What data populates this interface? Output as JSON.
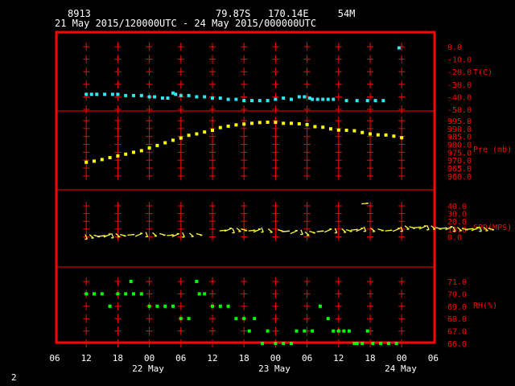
{
  "header": {
    "station": "8913",
    "location": "79.87S   170.14E     54M",
    "period": "21 May 2015/120000UTC - 24 May 2015/000000UTC"
  },
  "footer": {
    "page_number": "2"
  },
  "colors": {
    "frame": "#ff0000",
    "grid": "#ff0000",
    "text": "#ffffff",
    "temperature": "#33e5f0",
    "pressure": "#ffff00",
    "wind": "#ffff33",
    "rh": "#00ff00"
  },
  "chart_data": {
    "type": "scatter",
    "x_axis": {
      "tick_labels": [
        "06",
        "12",
        "18",
        "00",
        "06",
        "12",
        "18",
        "00",
        "06",
        "12",
        "18",
        "00",
        "06"
      ],
      "day_labels": [
        "22 May",
        "23 May",
        "24 May"
      ],
      "range_hours": [
        0,
        72
      ]
    },
    "panels": [
      {
        "name": "temperature",
        "label": "T(C)",
        "tick_labels": [
          "0.0",
          "-10.0",
          "-20.0",
          "-30.0",
          "-40.0",
          "-50.0"
        ],
        "ylim": [
          -50,
          0
        ],
        "points": [
          [
            6.0,
            -38
          ],
          [
            7.0,
            -38
          ],
          [
            8.0,
            -38
          ],
          [
            9.5,
            -38
          ],
          [
            11,
            -38
          ],
          [
            12,
            -38
          ],
          [
            13.5,
            -39
          ],
          [
            15,
            -39
          ],
          [
            16.5,
            -39
          ],
          [
            18,
            -40
          ],
          [
            19,
            -40
          ],
          [
            20.5,
            -41
          ],
          [
            21.5,
            -41
          ],
          [
            22.5,
            -37
          ],
          [
            23,
            -38
          ],
          [
            24,
            -39
          ],
          [
            25.5,
            -39
          ],
          [
            27,
            -40
          ],
          [
            28.5,
            -40
          ],
          [
            30,
            -41
          ],
          [
            31.5,
            -41
          ],
          [
            33,
            -42
          ],
          [
            34.5,
            -42
          ],
          [
            36,
            -43
          ],
          [
            37.5,
            -43
          ],
          [
            39,
            -43
          ],
          [
            40.5,
            -43
          ],
          [
            42,
            -42
          ],
          [
            43.5,
            -41
          ],
          [
            45,
            -42
          ],
          [
            46.5,
            -40
          ],
          [
            47.5,
            -40
          ],
          [
            48.5,
            -41
          ],
          [
            49,
            -42
          ],
          [
            50,
            -42
          ],
          [
            51,
            -42
          ],
          [
            52,
            -42
          ],
          [
            53,
            -42
          ],
          [
            55.5,
            -43
          ],
          [
            57.5,
            -43
          ],
          [
            59.5,
            -43
          ],
          [
            61,
            -43
          ],
          [
            62.5,
            -43
          ],
          [
            65.5,
            -1
          ]
        ]
      },
      {
        "name": "pressure",
        "label": "Pre (mb)",
        "tick_labels": [
          "995.0",
          "990.0",
          "985.0",
          "980.0",
          "975.0",
          "970.0",
          "965.0",
          "960.0"
        ],
        "ylim": [
          960,
          998
        ],
        "points": [
          [
            6,
            968.7
          ],
          [
            7.5,
            969.4
          ],
          [
            9,
            970.4
          ],
          [
            10.5,
            971.6
          ],
          [
            12,
            972.7
          ],
          [
            13.5,
            973.8
          ],
          [
            15,
            975
          ],
          [
            16.5,
            976
          ],
          [
            18,
            977.7
          ],
          [
            19.5,
            979.3
          ],
          [
            21,
            981
          ],
          [
            22.5,
            982.6
          ],
          [
            24,
            984
          ],
          [
            25.5,
            985.7
          ],
          [
            27,
            986.6
          ],
          [
            28.5,
            987.8
          ],
          [
            30,
            988.9
          ],
          [
            31.5,
            990.6
          ],
          [
            33,
            991.5
          ],
          [
            34.5,
            992.3
          ],
          [
            36,
            992.8
          ],
          [
            37.5,
            993.3
          ],
          [
            39,
            993.8
          ],
          [
            40.5,
            994
          ],
          [
            42,
            993.9
          ],
          [
            43.5,
            993.3
          ],
          [
            45,
            993.3
          ],
          [
            46.5,
            993
          ],
          [
            48,
            992.5
          ],
          [
            49.5,
            991.2
          ],
          [
            51,
            990.8
          ],
          [
            52.5,
            989.8
          ],
          [
            54,
            989
          ],
          [
            55.5,
            988.9
          ],
          [
            57,
            988.6
          ],
          [
            58.5,
            987.5
          ],
          [
            60,
            986.6
          ],
          [
            61.5,
            986
          ],
          [
            63,
            985.9
          ],
          [
            64.5,
            985.2
          ],
          [
            66,
            984.2
          ]
        ]
      },
      {
        "name": "wind_speed",
        "label": "SPD(MPS)",
        "tick_labels": [
          "40.0",
          "30.0",
          "20.0",
          "10.0",
          "0.0"
        ],
        "ylim": [
          0,
          48
        ],
        "points": [
          [
            6,
            0
          ],
          [
            7,
            0.5
          ],
          [
            8,
            1
          ],
          [
            9,
            1
          ],
          [
            10,
            1.5
          ],
          [
            11,
            1.5
          ],
          [
            12,
            2
          ],
          [
            13,
            2
          ],
          [
            14.5,
            2.5
          ],
          [
            16,
            2.5
          ],
          [
            17.5,
            3
          ],
          [
            19,
            3
          ],
          [
            20.5,
            3
          ],
          [
            22,
            2
          ],
          [
            23,
            2
          ],
          [
            24.5,
            2.5
          ],
          [
            26,
            2.5
          ],
          [
            27.5,
            3
          ],
          [
            32,
            8
          ],
          [
            33,
            9
          ],
          [
            34,
            8
          ],
          [
            35,
            9
          ],
          [
            36,
            9
          ],
          [
            37.5,
            8
          ],
          [
            38.5,
            8
          ],
          [
            39.5,
            9
          ],
          [
            41,
            8
          ],
          [
            43,
            8
          ],
          [
            44,
            7
          ],
          [
            45.5,
            6
          ],
          [
            47,
            6
          ],
          [
            48,
            4
          ],
          [
            49,
            6
          ],
          [
            50.5,
            7
          ],
          [
            52,
            8
          ],
          [
            53.5,
            8
          ],
          [
            55,
            8
          ],
          [
            56,
            8
          ],
          [
            57,
            9
          ],
          [
            58,
            9
          ],
          [
            59,
            10
          ],
          [
            60.5,
            9
          ],
          [
            62,
            9
          ],
          [
            63.5,
            8
          ],
          [
            65,
            9
          ],
          [
            66,
            10
          ],
          [
            67,
            12
          ],
          [
            68,
            12
          ],
          [
            69,
            12
          ],
          [
            70,
            12
          ],
          [
            71,
            12
          ],
          [
            72,
            12
          ],
          [
            73,
            11
          ],
          [
            74,
            11
          ],
          [
            75,
            11
          ],
          [
            76,
            10
          ],
          [
            77,
            10
          ],
          [
            78,
            10
          ],
          [
            79,
            10
          ],
          [
            80,
            10
          ],
          [
            81,
            10
          ],
          [
            82,
            10
          ],
          [
            83,
            10
          ],
          [
            59,
            43
          ]
        ]
      },
      {
        "name": "relative_humidity",
        "label": "RH(%)",
        "tick_labels": [
          "71.0",
          "70.0",
          "69.0",
          "68.0",
          "67.0",
          "66.0"
        ],
        "ylim": [
          66,
          72
        ],
        "points": [
          [
            6,
            70
          ],
          [
            7.5,
            70
          ],
          [
            9,
            70
          ],
          [
            10.5,
            69
          ],
          [
            12,
            70
          ],
          [
            13.5,
            70
          ],
          [
            14.5,
            71
          ],
          [
            15,
            70
          ],
          [
            16.5,
            70
          ],
          [
            18,
            69
          ],
          [
            19.5,
            69
          ],
          [
            21,
            69
          ],
          [
            22.5,
            69
          ],
          [
            24,
            68
          ],
          [
            25.5,
            68
          ],
          [
            27,
            71
          ],
          [
            27.5,
            70
          ],
          [
            28.5,
            70
          ],
          [
            30,
            69
          ],
          [
            31.5,
            69
          ],
          [
            33,
            69
          ],
          [
            34.5,
            68
          ],
          [
            36,
            68
          ],
          [
            37,
            67
          ],
          [
            38,
            68
          ],
          [
            39.5,
            66
          ],
          [
            40.5,
            67
          ],
          [
            42,
            66
          ],
          [
            43.5,
            66
          ],
          [
            45,
            66
          ],
          [
            46,
            67
          ],
          [
            47.5,
            67
          ],
          [
            49,
            67
          ],
          [
            50.5,
            69
          ],
          [
            52,
            68
          ],
          [
            53,
            67
          ],
          [
            54,
            67
          ],
          [
            55,
            67
          ],
          [
            56,
            67
          ],
          [
            57,
            66
          ],
          [
            57.5,
            66
          ],
          [
            58.5,
            66
          ],
          [
            59.5,
            67
          ],
          [
            60.5,
            66
          ],
          [
            62,
            66
          ],
          [
            63.5,
            66
          ],
          [
            65,
            66
          ]
        ]
      }
    ]
  }
}
